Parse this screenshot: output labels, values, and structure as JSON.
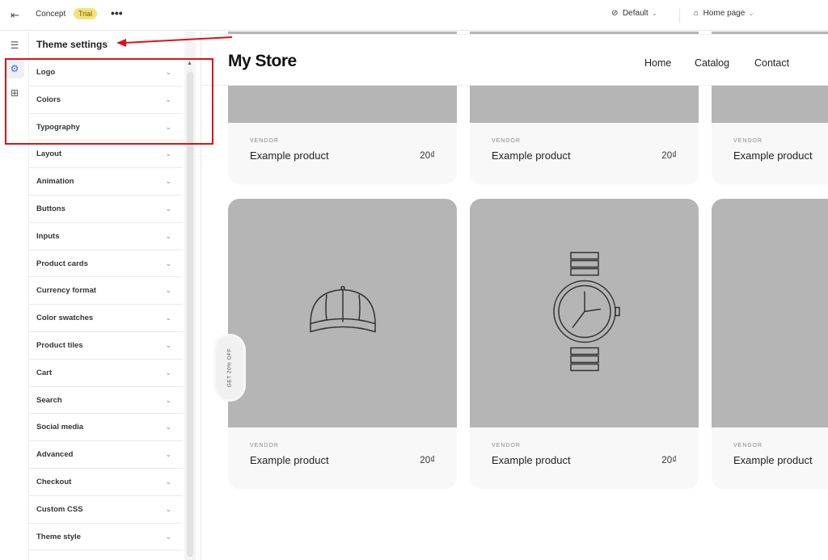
{
  "topbar": {
    "theme_name": "Concept",
    "badge": "Trial",
    "more": "•••",
    "language": "Default",
    "page": "Home page"
  },
  "sidebar": {
    "title": "Theme settings",
    "items": [
      {
        "label": "Logo"
      },
      {
        "label": "Colors"
      },
      {
        "label": "Typography"
      },
      {
        "label": "Layout"
      },
      {
        "label": "Animation"
      },
      {
        "label": "Buttons"
      },
      {
        "label": "Inputs"
      },
      {
        "label": "Product cards"
      },
      {
        "label": "Currency format"
      },
      {
        "label": "Color swatches"
      },
      {
        "label": "Product tiles"
      },
      {
        "label": "Cart"
      },
      {
        "label": "Search"
      },
      {
        "label": "Social media"
      },
      {
        "label": "Advanced"
      },
      {
        "label": "Checkout"
      },
      {
        "label": "Custom CSS"
      },
      {
        "label": "Theme style"
      }
    ]
  },
  "preview": {
    "store_name": "My Store",
    "nav": [
      "Home",
      "Catalog",
      "Contact"
    ],
    "promo": "GET 20% OFF",
    "products": [
      {
        "vendor": "VENDOR",
        "name": "Example product",
        "price": "20₫"
      },
      {
        "vendor": "VENDOR",
        "name": "Example product",
        "price": "20₫"
      },
      {
        "vendor": "VENDOR",
        "name": "Example product",
        "price": ""
      },
      {
        "vendor": "VENDOR",
        "name": "Example product",
        "price": "20₫",
        "icon": "cap"
      },
      {
        "vendor": "VENDOR",
        "name": "Example product",
        "price": "20₫",
        "icon": "watch"
      },
      {
        "vendor": "VENDOR",
        "name": "Example product",
        "price": "",
        "icon": "lamp"
      }
    ]
  },
  "annotation_color": "#d8141a"
}
